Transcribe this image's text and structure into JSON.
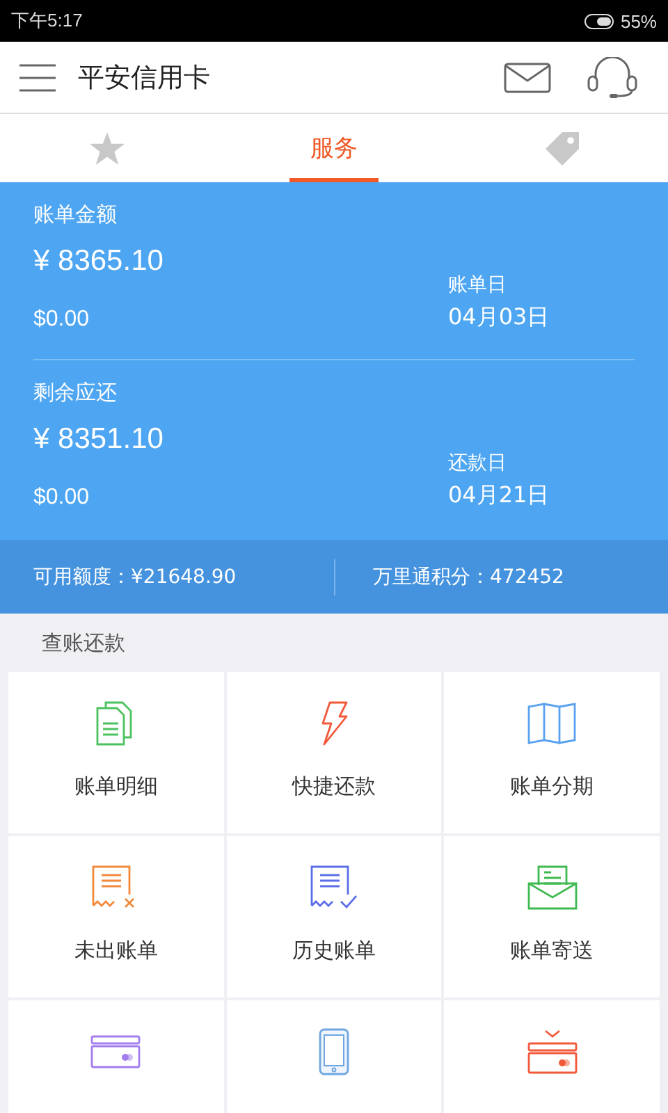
{
  "status_bar": {
    "time": "下午5:17",
    "battery": "55%"
  },
  "header": {
    "title": "平安信用卡"
  },
  "tabs": [
    {
      "selected": false
    },
    {
      "label": "服务",
      "selected": true
    },
    {
      "selected": false
    }
  ],
  "bills": [
    {
      "label": "账单金额",
      "amount": "¥ 8365.10",
      "usd": "$0.00",
      "date_label": "账单日",
      "date": "04月03日"
    },
    {
      "label": "剩余应还",
      "amount": "¥ 8351.10",
      "usd": "$0.00",
      "date_label": "还款日",
      "date": "04月21日"
    }
  ],
  "summary": {
    "credit": "可用额度：¥21648.90",
    "points": "万里通积分：472452"
  },
  "section": {
    "title": "查账还款"
  },
  "services": [
    {
      "kind": "full",
      "label": "账单明细"
    },
    {
      "kind": "full",
      "label": "快捷还款"
    },
    {
      "kind": "full",
      "label": "账单分期"
    },
    {
      "kind": "full",
      "label": "未出账单"
    },
    {
      "kind": "full",
      "label": "历史账单"
    },
    {
      "kind": "full",
      "label": "账单寄送"
    },
    {
      "kind": "cut"
    },
    {
      "kind": "cut"
    },
    {
      "kind": "cut"
    }
  ]
}
